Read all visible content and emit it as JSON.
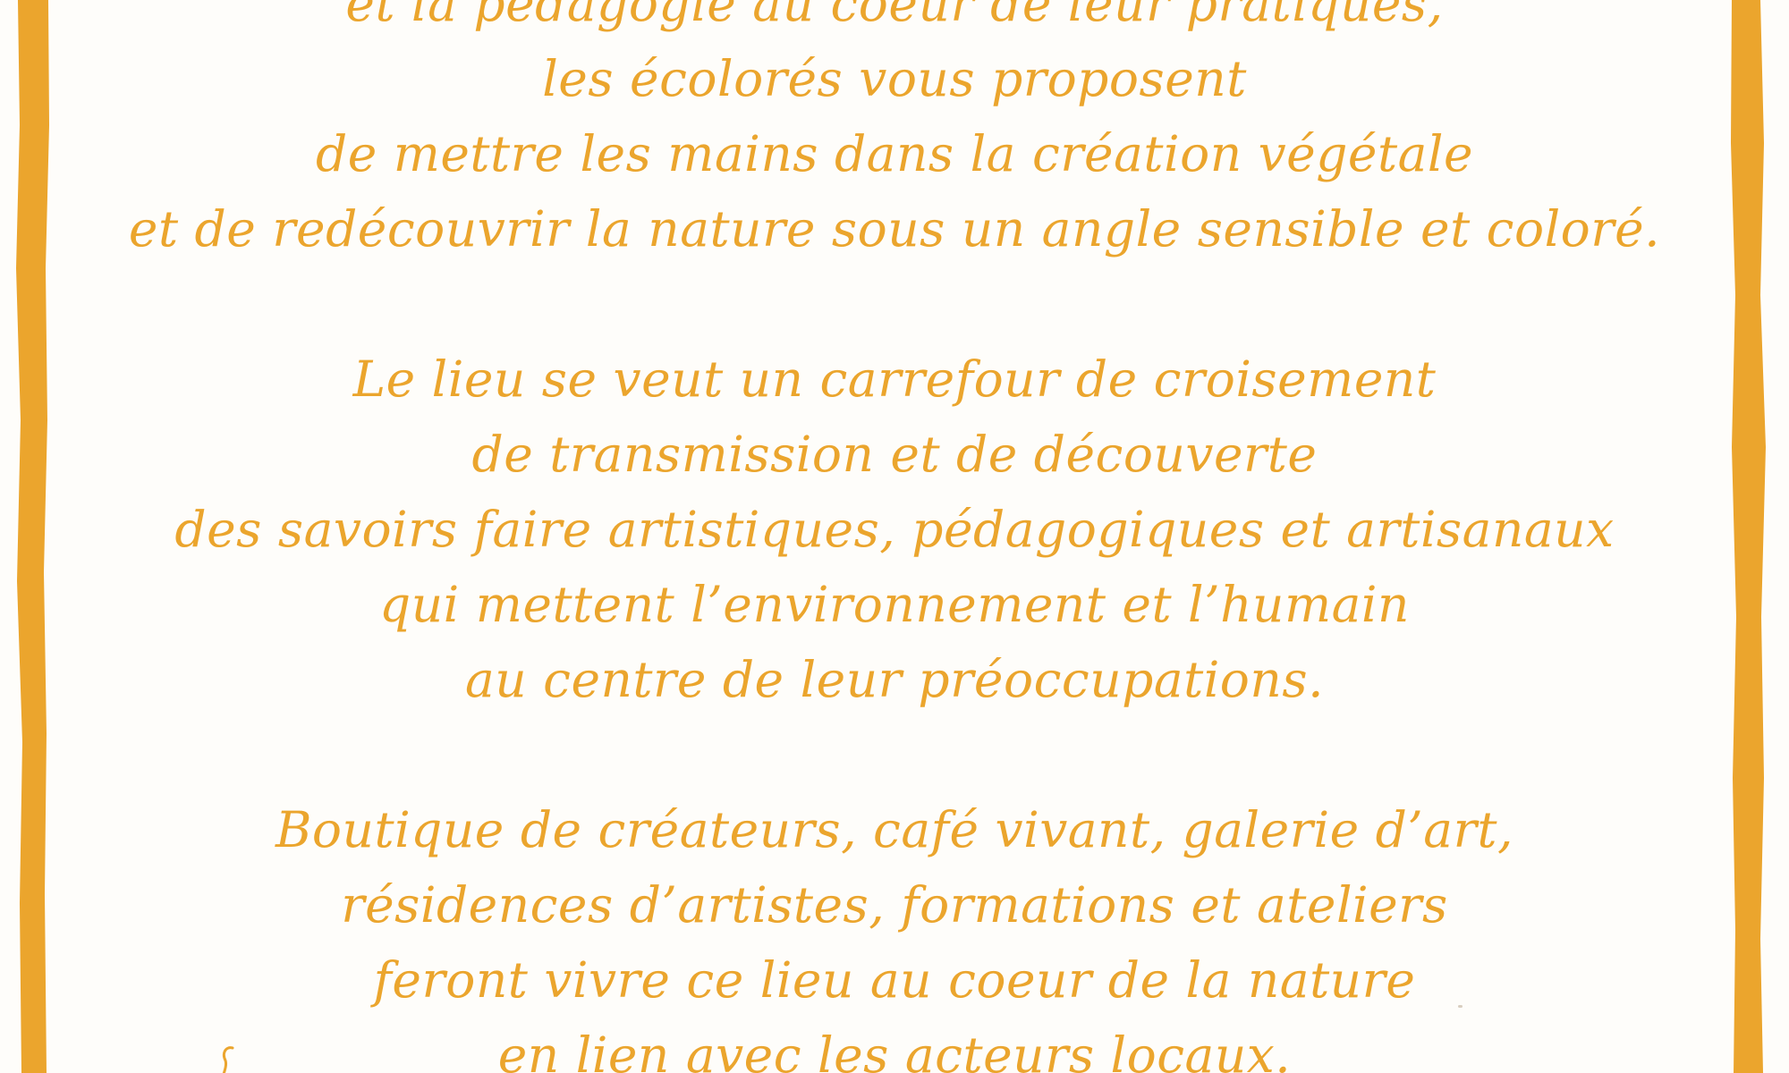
{
  "document": {
    "paragraph_1": [
      "et la pédagogie au coeur de leur pratiques,",
      "les écolorés vous proposent",
      "de mettre les mains dans la création végétale",
      "et de redécouvrir la nature sous un angle sensible et coloré."
    ],
    "paragraph_2": [
      "Le lieu se veut un carrefour de croisement",
      "de transmission et de découverte",
      "des savoirs faire artistiques, pédagogiques et artisanaux",
      "qui mettent l’environnement et l’humain",
      "au centre de leur préoccupations."
    ],
    "paragraph_3": [
      "Boutique de créateurs, café vivant, galerie d’art,",
      "résidences d’artistes, formations et ateliers",
      "feront vivre ce lieu au coeur de la nature",
      "en lien avec les acteurs locaux."
    ]
  },
  "colors": {
    "text": "#eba52d",
    "border": "#eba52d",
    "background": "#fefdfa"
  }
}
